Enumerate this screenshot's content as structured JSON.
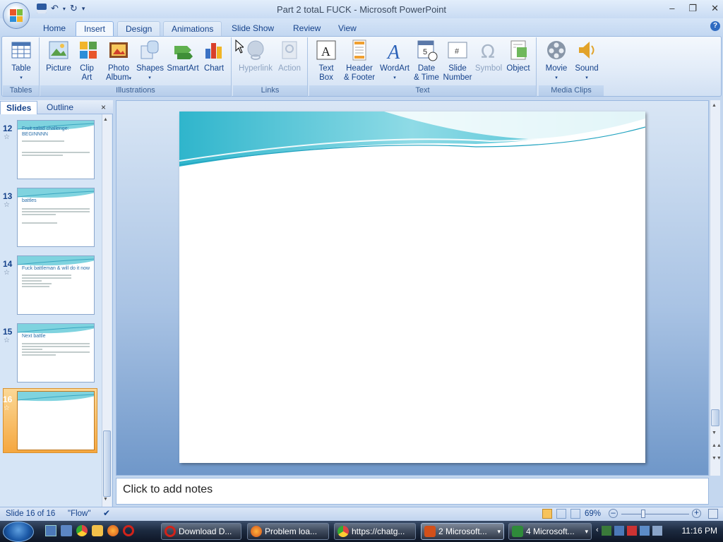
{
  "window": {
    "title": "Part 2 totaL FUCK - Microsoft PowerPoint"
  },
  "tabs": [
    {
      "label": "Home"
    },
    {
      "label": "Insert"
    },
    {
      "label": "Design"
    },
    {
      "label": "Animations"
    },
    {
      "label": "Slide Show"
    },
    {
      "label": "Review"
    },
    {
      "label": "View"
    }
  ],
  "ribbon": {
    "groups": {
      "tables": "Tables",
      "illustrations": "Illustrations",
      "links": "Links",
      "text": "Text",
      "media": "Media Clips"
    },
    "buttons": {
      "table": "Table",
      "picture": "Picture",
      "clipart1": "Clip",
      "clipart2": "Art",
      "photo1": "Photo",
      "photo2": "Album",
      "shapes": "Shapes",
      "smartart": "SmartArt",
      "chart": "Chart",
      "hyperlink": "Hyperlink",
      "action": "Action",
      "textbox1": "Text",
      "textbox2": "Box",
      "header1": "Header",
      "header2": "& Footer",
      "wordart": "WordArt",
      "date1": "Date",
      "date2": "& Time",
      "slidenum1": "Slide",
      "slidenum2": "Number",
      "symbol": "Symbol",
      "object": "Object",
      "movie": "Movie",
      "sound": "Sound"
    }
  },
  "pane": {
    "tab_slides": "Slides",
    "tab_outline": "Outline",
    "close": "×"
  },
  "slides": [
    {
      "num": "12",
      "title": "Fruit salad challenge: BEGINNNN"
    },
    {
      "num": "13",
      "title": "battles"
    },
    {
      "num": "14",
      "title": "Fuck battleman & will do it now"
    },
    {
      "num": "15",
      "title": "Next battle"
    },
    {
      "num": "16",
      "title": ""
    }
  ],
  "notes": {
    "placeholder": "Click to add notes"
  },
  "status": {
    "slide": "Slide 16 of 16",
    "theme": "\"Flow\"",
    "zoom": "69%",
    "zoom_level": 0.69
  },
  "taskbar": {
    "items": [
      {
        "label": "Download D..."
      },
      {
        "label": "Problem loa..."
      },
      {
        "label": "https://chatg..."
      },
      {
        "label": "2 Microsoft..."
      },
      {
        "label": "4 Microsoft..."
      }
    ],
    "clock": "11:16 PM"
  },
  "colors": {
    "accent": "#15428b",
    "selected_slide": "#f5a740",
    "slide_wave": "#4fc3d4"
  }
}
